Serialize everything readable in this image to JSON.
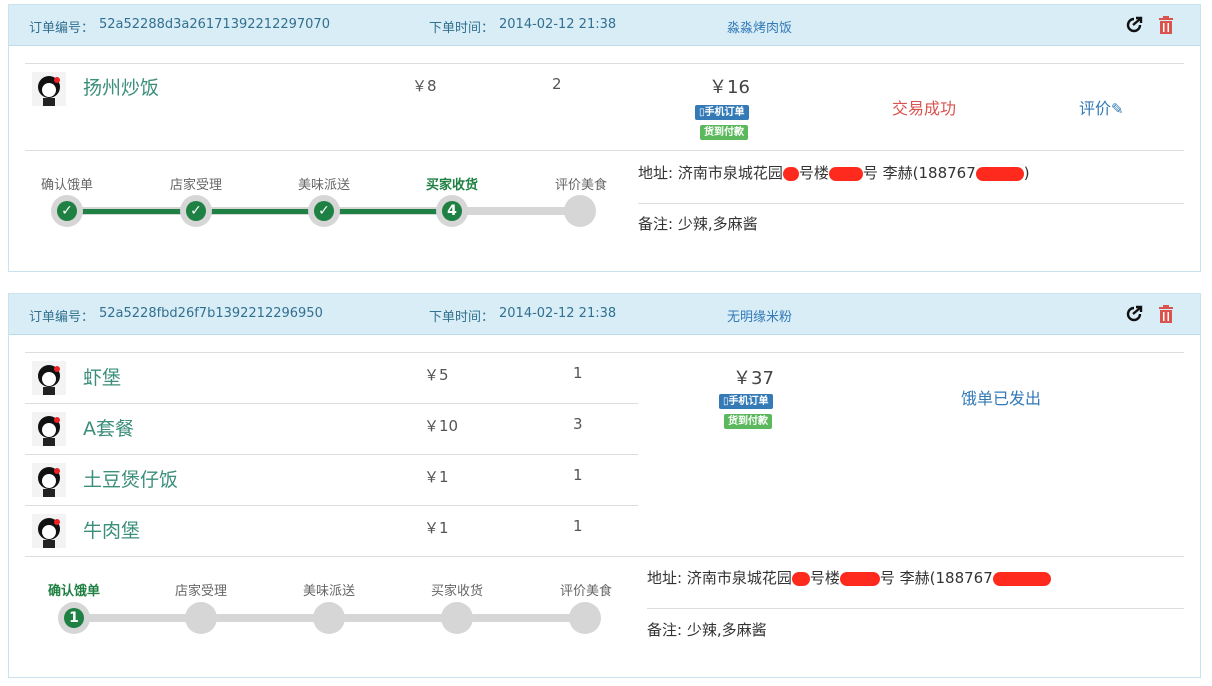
{
  "orders": [
    {
      "order_id_label": "订单编号：",
      "order_id": "52a52288d3a26171392212297070",
      "time_label": "下单时间：",
      "time": "2014-02-12 21:38",
      "shop": "淼淼烤肉饭",
      "items": [
        {
          "name": "扬州炒饭",
          "price": "￥8",
          "qty": "2"
        }
      ],
      "total": "￥16",
      "badge_mobile": "手机订单",
      "badge_cod": "货到付款",
      "status": "交易成功",
      "review_label": "评价",
      "steps": [
        "确认饿单",
        "店家受理",
        "美味派送",
        "买家收货",
        "评价美食"
      ],
      "current_step_number": "4",
      "address_label": "地址:",
      "address_text": "济南市泉城花园",
      "address_mid1": "号楼",
      "address_mid2": "号 李赫(188767",
      "address_end": ")",
      "note_label": "备注:",
      "note": "少辣,多麻酱"
    },
    {
      "order_id_label": "订单编号：",
      "order_id": "52a5228fbd26f7b1392212296950",
      "time_label": "下单时间：",
      "time": "2014-02-12 21:38",
      "shop": "无明缘米粉",
      "items": [
        {
          "name": "虾堡",
          "price": "￥5",
          "qty": "1"
        },
        {
          "name": "A套餐",
          "price": "￥10",
          "qty": "3"
        },
        {
          "name": "土豆煲仔饭",
          "price": "￥1",
          "qty": "1"
        },
        {
          "name": "牛肉堡",
          "price": "￥1",
          "qty": "1"
        }
      ],
      "total": "￥37",
      "badge_mobile": "手机订单",
      "badge_cod": "货到付款",
      "status": "饿单已发出",
      "steps": [
        "确认饿单",
        "店家受理",
        "美味派送",
        "买家收货",
        "评价美食"
      ],
      "current_step_number": "1",
      "address_label": "地址:",
      "address_text": "济南市泉城花园",
      "address_mid1": "号楼",
      "address_mid2": "号 李赫(188767",
      "address_end": "",
      "note_label": "备注:",
      "note": "少辣,多麻酱"
    }
  ],
  "colors": {
    "accent": "#1e8042",
    "header_bg": "#d9edf7",
    "link": "#337ab7",
    "danger": "#d9534f"
  },
  "icons": {
    "share": "share-icon",
    "trash": "trash-icon",
    "pencil": "pencil-icon",
    "phone": "phone-icon",
    "check": "check-icon"
  }
}
